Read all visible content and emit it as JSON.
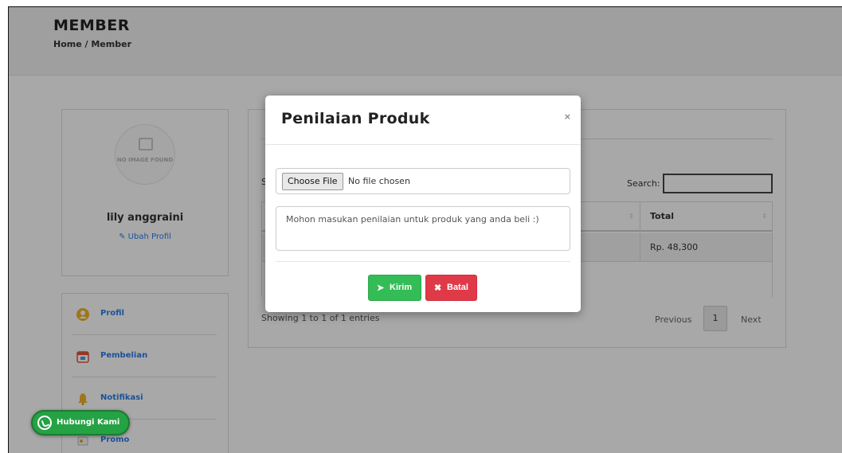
{
  "header": {
    "title": "MEMBER",
    "breadcrumb": "Home / Member"
  },
  "profile": {
    "avatar_placeholder": "NO IMAGE FOUND",
    "name": "lily anggraini",
    "edit_label": "Ubah Profil"
  },
  "sidebar": {
    "items": [
      {
        "label": "Profil",
        "icon": "user-icon"
      },
      {
        "label": "Pembelian",
        "icon": "calendar-icon"
      },
      {
        "label": "Notifikasi",
        "icon": "bell-icon"
      },
      {
        "label": "Promo",
        "icon": "tag-icon"
      }
    ]
  },
  "table": {
    "length_label": "S",
    "search_label": "Search:",
    "columns": {
      "total": "Total"
    },
    "rows": [
      {
        "total": "Rp. 48,300"
      }
    ],
    "info": "Showing 1 to 1 of 1 entries",
    "pagination": {
      "previous": "Previous",
      "current_page": "1",
      "next": "Next"
    }
  },
  "modal": {
    "title": "Penilaian Produk",
    "close_symbol": "×",
    "file_button": "Choose File",
    "file_status": "No file chosen",
    "textarea_placeholder": "Mohon masukan penilaian untuk produk yang anda beli :)",
    "send_label": "Kirim",
    "cancel_label": "Batal"
  },
  "whatsapp": {
    "label": "Hubungi Kami"
  },
  "colors": {
    "send": "#34bc56",
    "cancel": "#e03a49",
    "link": "#2b7de9",
    "whatsapp": "#25a244"
  }
}
